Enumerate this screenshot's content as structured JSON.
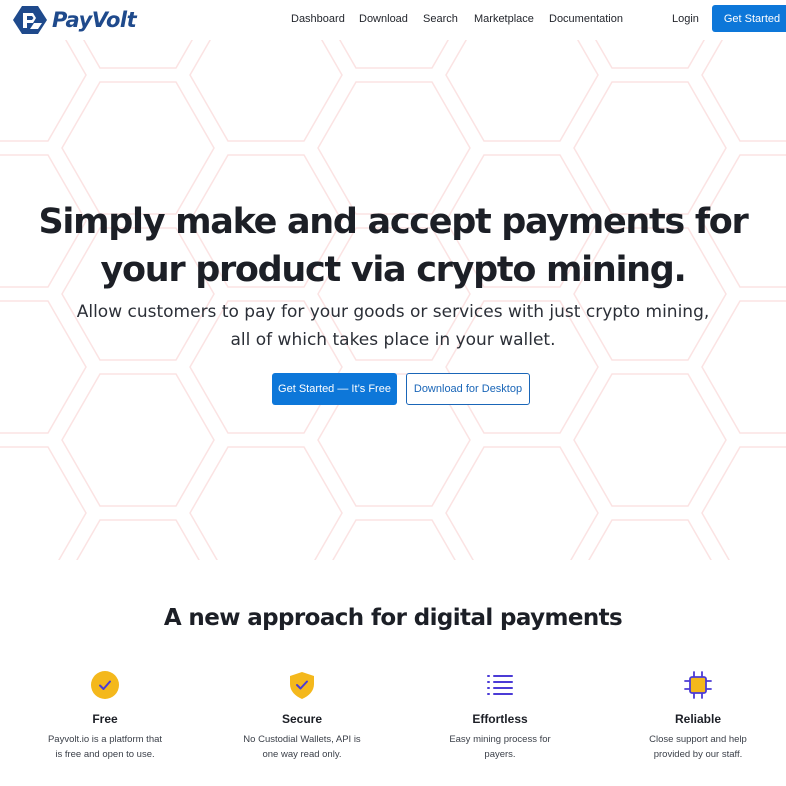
{
  "brand": {
    "name": "PayVolt"
  },
  "nav": {
    "links": [
      "Dashboard",
      "Download",
      "Search",
      "Marketplace",
      "Documentation"
    ],
    "login": "Login",
    "cta": "Get Started"
  },
  "hero": {
    "title_line1": "Simply make and accept payments for",
    "title_line2": "your product via crypto mining.",
    "subtitle_line1": "Allow customers to pay for your goods or services with just crypto mining,",
    "subtitle_line2": "all of which takes place in your wallet.",
    "primary_button": "Get Started — It’s Free",
    "secondary_button": "Download for Desktop"
  },
  "features": {
    "title": "A new approach for digital payments",
    "items": [
      {
        "name": "Free",
        "desc_line1": "Payvolt.io is a platform that",
        "desc_line2": "is free and open to use.",
        "icon": "check-circle-icon"
      },
      {
        "name": "Secure",
        "desc_line1": "No Custodial Wallets, API is",
        "desc_line2": "one way read only.",
        "icon": "shield-check-icon"
      },
      {
        "name": "Effortless",
        "desc_line1": "Easy mining process for",
        "desc_line2": "payers.",
        "icon": "list-icon"
      },
      {
        "name": "Reliable",
        "desc_line1": "Close support and help",
        "desc_line2": "provided by our staff.",
        "icon": "chip-icon"
      }
    ]
  },
  "colors": {
    "accent": "#0d77d9",
    "brand": "#1f4a8c",
    "icon_yellow": "#f4b81c",
    "icon_purple": "#4b3bd6",
    "hex_stroke": "#fbe3e3"
  }
}
